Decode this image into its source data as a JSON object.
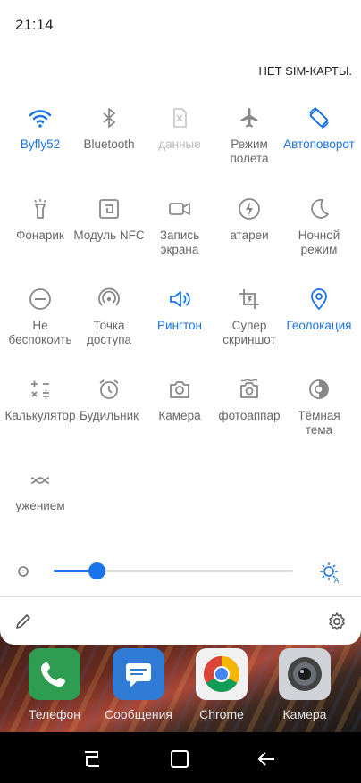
{
  "status_bar": {
    "time": "21:14"
  },
  "sim_status": "НЕТ SIM-КАРТЫ.",
  "tiles": [
    {
      "label": "Byfly52",
      "icon": "wifi-icon",
      "active": true
    },
    {
      "label": "Bluetooth",
      "icon": "bluetooth-icon",
      "active": false
    },
    {
      "label": "данные",
      "icon": "mobile-data-icon",
      "active": false
    },
    {
      "label": "Режим полета",
      "icon": "airplane-icon",
      "active": false
    },
    {
      "label": "Автоповорот",
      "icon": "auto-rotate-icon",
      "active": true
    },
    {
      "label": "Фонарик",
      "icon": "flashlight-icon",
      "active": false
    },
    {
      "label": "Модуль NFC",
      "icon": "nfc-icon",
      "active": false
    },
    {
      "label": "Запись экрана",
      "icon": "screen-record-icon",
      "active": false
    },
    {
      "label": "атареи",
      "icon": "battery-saver-icon",
      "active": false
    },
    {
      "label": "Ночной режим",
      "icon": "night-mode-icon",
      "active": false
    },
    {
      "label": "Не беспокоить",
      "icon": "do-not-disturb-icon",
      "active": false
    },
    {
      "label": "Точка доступа",
      "icon": "hotspot-icon",
      "active": false
    },
    {
      "label": "Рингтон",
      "icon": "ringtone-icon",
      "active": true
    },
    {
      "label": "Супер скриншот",
      "icon": "super-screenshot-icon",
      "active": false
    },
    {
      "label": "Геолокация",
      "icon": "location-icon",
      "active": true
    },
    {
      "label": "Калькулятор",
      "icon": "calculator-icon",
      "active": false
    },
    {
      "label": "Будильник",
      "icon": "alarm-icon",
      "active": false
    },
    {
      "label": "Камера",
      "icon": "camera-icon",
      "active": false
    },
    {
      "label": "фотоаппар",
      "icon": "front-camera-icon",
      "active": false
    },
    {
      "label": "Тёмная тема",
      "icon": "dark-theme-icon",
      "active": false
    },
    {
      "label": "ужением",
      "icon": "data-saver-icon",
      "active": false
    }
  ],
  "brightness": {
    "level": 0.18,
    "auto_icon": "auto-brightness-icon"
  },
  "footer": {
    "edit_icon": "pencil-icon",
    "settings_icon": "gear-icon"
  },
  "dock": [
    {
      "name": "Телефон",
      "icon": "phone-app-icon",
      "color": "#2e9d52"
    },
    {
      "name": "Сообщения",
      "icon": "messages-app-icon",
      "color": "#2f7bd6"
    },
    {
      "name": "Chrome",
      "icon": "chrome-app-icon",
      "color": "#ffffff"
    },
    {
      "name": "Камера",
      "icon": "camera-app-icon",
      "color": "#cfd3d8"
    }
  ],
  "colors": {
    "accent": "#1a73e8",
    "icon_gray": "#666666"
  }
}
